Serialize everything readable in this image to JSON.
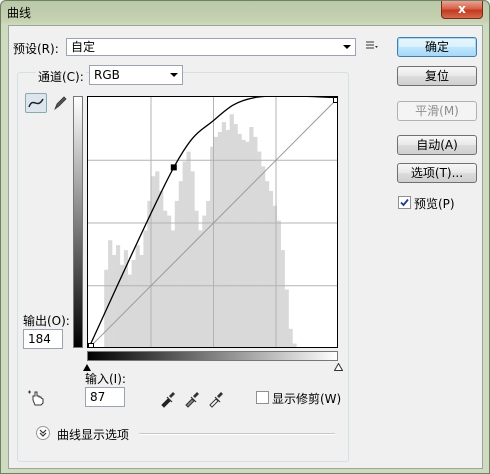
{
  "window": {
    "title": "曲线",
    "close_label": "x"
  },
  "preset": {
    "label": "预设(R):",
    "value": "自定"
  },
  "channel": {
    "label": "通道(C):",
    "value": "RGB"
  },
  "buttons": {
    "ok": "确定",
    "reset": "复位",
    "smooth": "平滑(M)",
    "auto": "自动(A)",
    "options": "选项(T)..."
  },
  "preview": {
    "label": "预览(P)",
    "checked": true
  },
  "output": {
    "label": "输出(O):",
    "value": "184"
  },
  "input": {
    "label": "输入(I):",
    "value": "87"
  },
  "show_clipping": {
    "label": "显示修剪(W)",
    "checked": false
  },
  "curve_options": {
    "label": "曲线显示选项"
  },
  "chart_data": {
    "type": "line",
    "title": "",
    "xlabel": "输入(I):",
    "ylabel": "输出(O):",
    "xlim": [
      0,
      255
    ],
    "ylim": [
      0,
      255
    ],
    "grid": true,
    "series": [
      {
        "x": [
          0,
          87,
          128,
          170,
          255
        ],
        "y": [
          0,
          184,
          232,
          255,
          255
        ]
      }
    ],
    "reference_line": {
      "x": [
        0,
        255
      ],
      "y": [
        0,
        255
      ]
    },
    "control_points": {
      "x": [
        0,
        87,
        255
      ],
      "y": [
        0,
        184,
        255
      ]
    },
    "histogram": {
      "x": [
        0,
        4,
        8,
        12,
        16,
        20,
        24,
        28,
        32,
        36,
        40,
        44,
        48,
        52,
        56,
        60,
        64,
        68,
        72,
        76,
        80,
        84,
        88,
        92,
        96,
        100,
        104,
        108,
        112,
        116,
        120,
        124,
        128,
        132,
        136,
        140,
        144,
        148,
        152,
        156,
        160,
        164,
        168,
        172,
        176,
        180,
        184,
        188,
        192,
        196,
        200,
        204,
        208,
        212,
        216,
        220,
        224,
        228,
        232,
        236,
        240,
        244,
        248,
        252
      ],
      "y": [
        0,
        0,
        0,
        0,
        80,
        110,
        95,
        105,
        85,
        100,
        75,
        90,
        105,
        95,
        120,
        150,
        175,
        180,
        160,
        140,
        135,
        120,
        150,
        170,
        190,
        200,
        180,
        140,
        120,
        135,
        150,
        205,
        215,
        220,
        230,
        222,
        238,
        228,
        218,
        212,
        210,
        225,
        215,
        200,
        185,
        170,
        160,
        145,
        130,
        100,
        60,
        20,
        5,
        0,
        0,
        0,
        0,
        0,
        0,
        0,
        0,
        0,
        0,
        0
      ]
    }
  }
}
